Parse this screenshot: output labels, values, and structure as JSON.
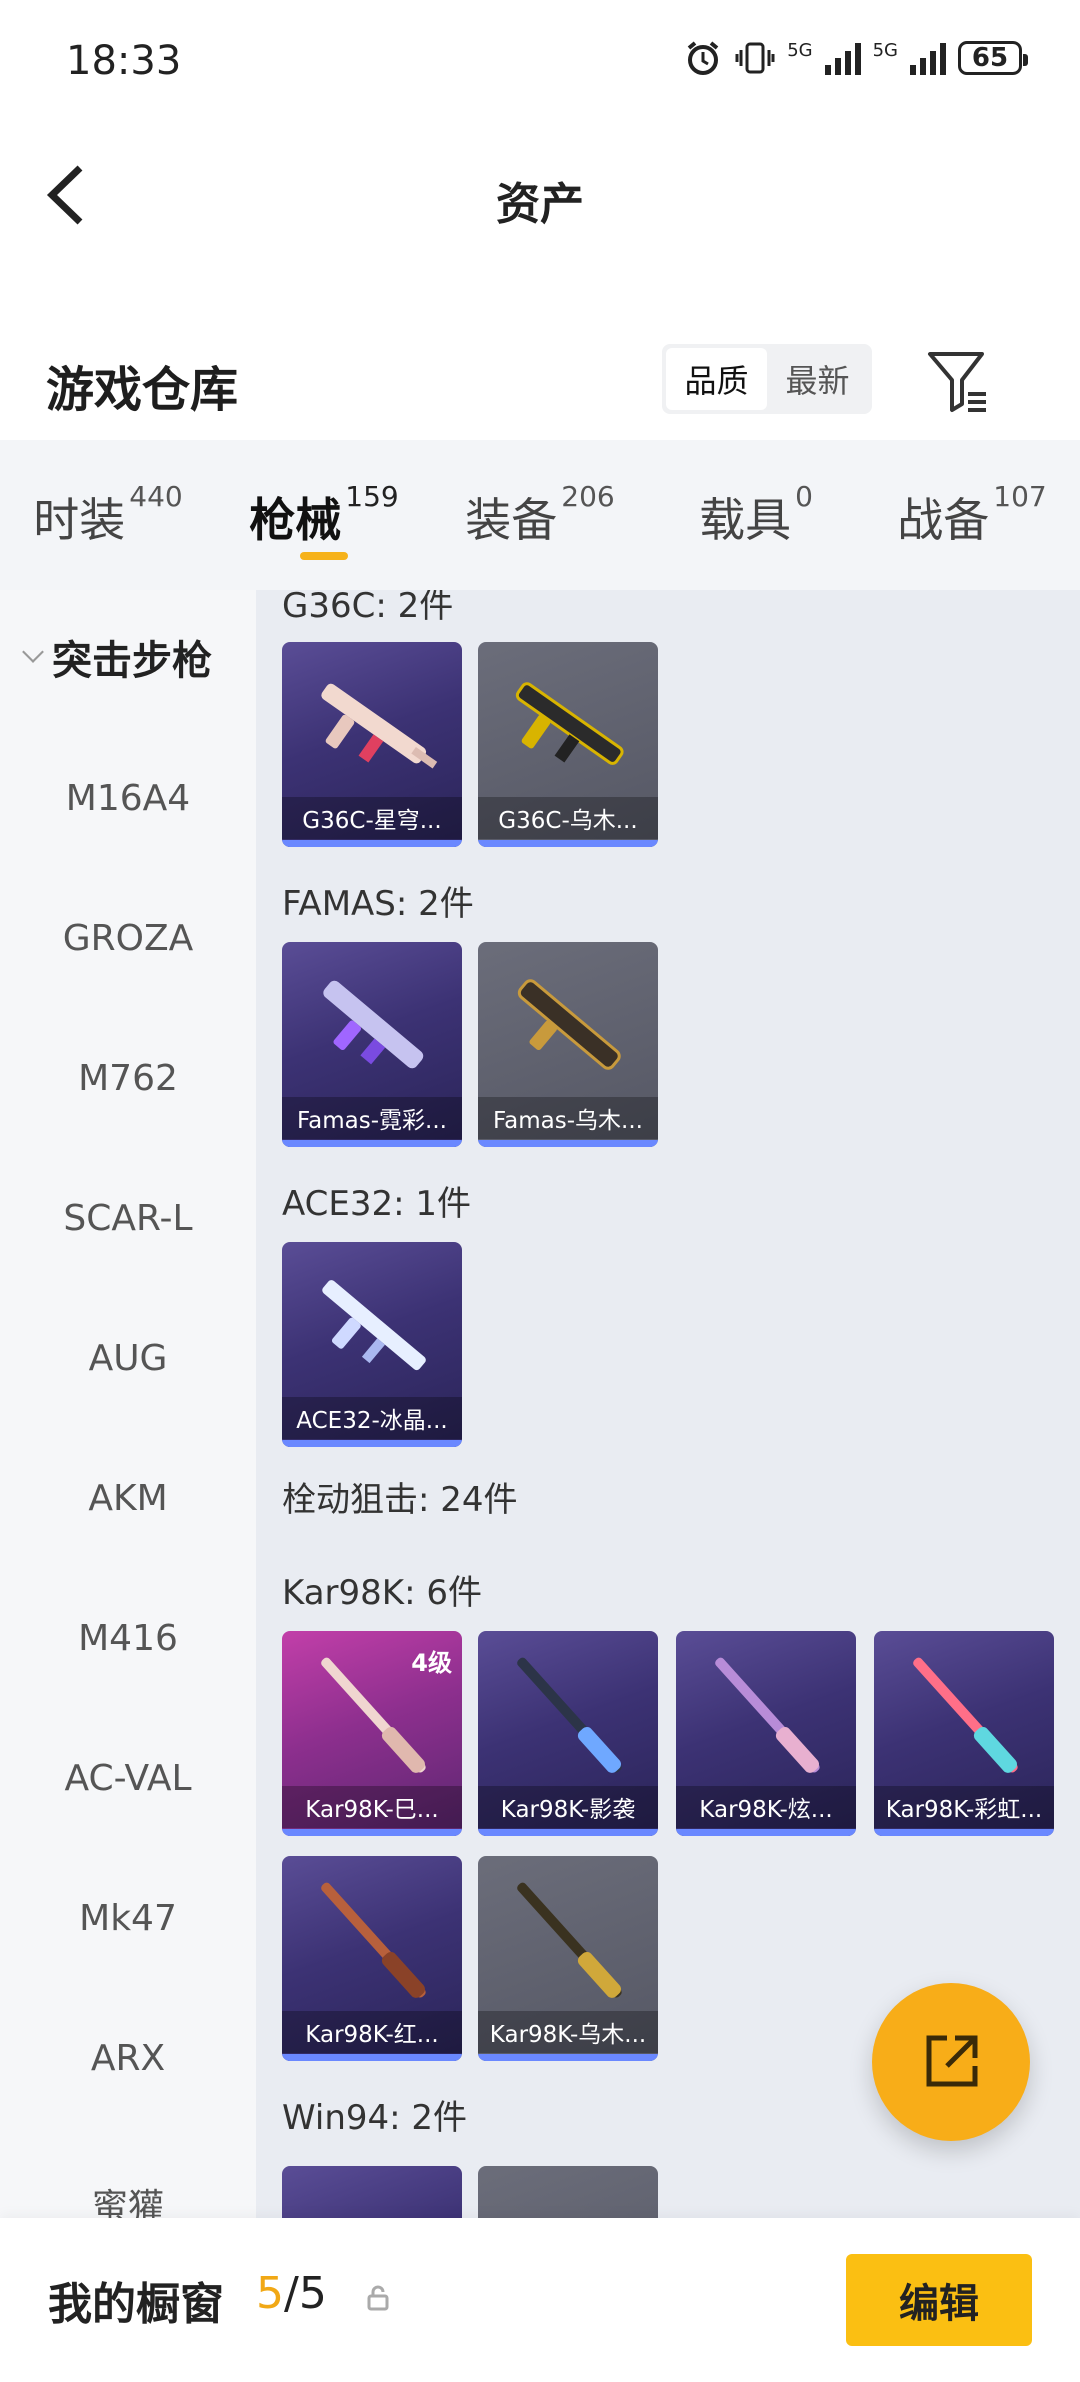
{
  "status_bar": {
    "time": "18:33",
    "network1": "5G",
    "network2": "5G",
    "battery": "65"
  },
  "header": {
    "title": "资产"
  },
  "section": {
    "title": "游戏仓库",
    "sort_options": [
      "品质",
      "最新"
    ],
    "sort_selected": "品质"
  },
  "tabs": [
    {
      "label": "时装",
      "count": "440"
    },
    {
      "label": "枪械",
      "count": "159"
    },
    {
      "label": "装备",
      "count": "206"
    },
    {
      "label": "载具",
      "count": "0"
    },
    {
      "label": "战备",
      "count": "107"
    }
  ],
  "sidebar": {
    "group": "突击步枪",
    "items": [
      "M16A4",
      "GROZA",
      "M762",
      "SCAR-L",
      "AUG",
      "AKM",
      "M416",
      "AC-VAL",
      "Mk47",
      "ARX",
      "蜜獾"
    ]
  },
  "main": {
    "groups": [
      {
        "title": "G36C: 2件",
        "cards": [
          {
            "label": "G36C-星穹...",
            "rarity": "purple"
          },
          {
            "label": "G36C-乌木...",
            "rarity": "gray"
          }
        ]
      },
      {
        "title": "FAMAS: 2件",
        "cards": [
          {
            "label": "Famas-霓彩...",
            "rarity": "purple"
          },
          {
            "label": "Famas-乌木...",
            "rarity": "gray"
          }
        ]
      },
      {
        "title": "ACE32: 1件",
        "cards": [
          {
            "label": "ACE32-冰晶...",
            "rarity": "purple"
          }
        ]
      },
      {
        "title": "栓动狙击: 24件"
      },
      {
        "title": "Kar98K: 6件",
        "cards": [
          {
            "label": "Kar98K-巳...",
            "rarity": "pink",
            "level": "4级"
          },
          {
            "label": "Kar98K-影袭",
            "rarity": "purple"
          },
          {
            "label": "Kar98K-炫...",
            "rarity": "purple"
          },
          {
            "label": "Kar98K-彩虹...",
            "rarity": "purple"
          },
          {
            "label": "Kar98K-红...",
            "rarity": "purple"
          },
          {
            "label": "Kar98K-乌木...",
            "rarity": "gray"
          }
        ]
      },
      {
        "title": "Win94: 2件"
      }
    ]
  },
  "bottom": {
    "label": "我的橱窗",
    "count_current": "5",
    "count_sep": "/5",
    "edit_label": "编辑"
  },
  "colors": {
    "accent": "#f8ad18",
    "purple_card": "#3c3274",
    "gray_card": "#555764",
    "pink_card": "#8d2f8e",
    "blue_bar": "#6a88ff"
  },
  "icons": [
    "back-arrow-icon",
    "alarm-icon",
    "vibrate-icon",
    "filter-icon",
    "share-export-icon",
    "lock-icon",
    "chevron-down-icon"
  ]
}
